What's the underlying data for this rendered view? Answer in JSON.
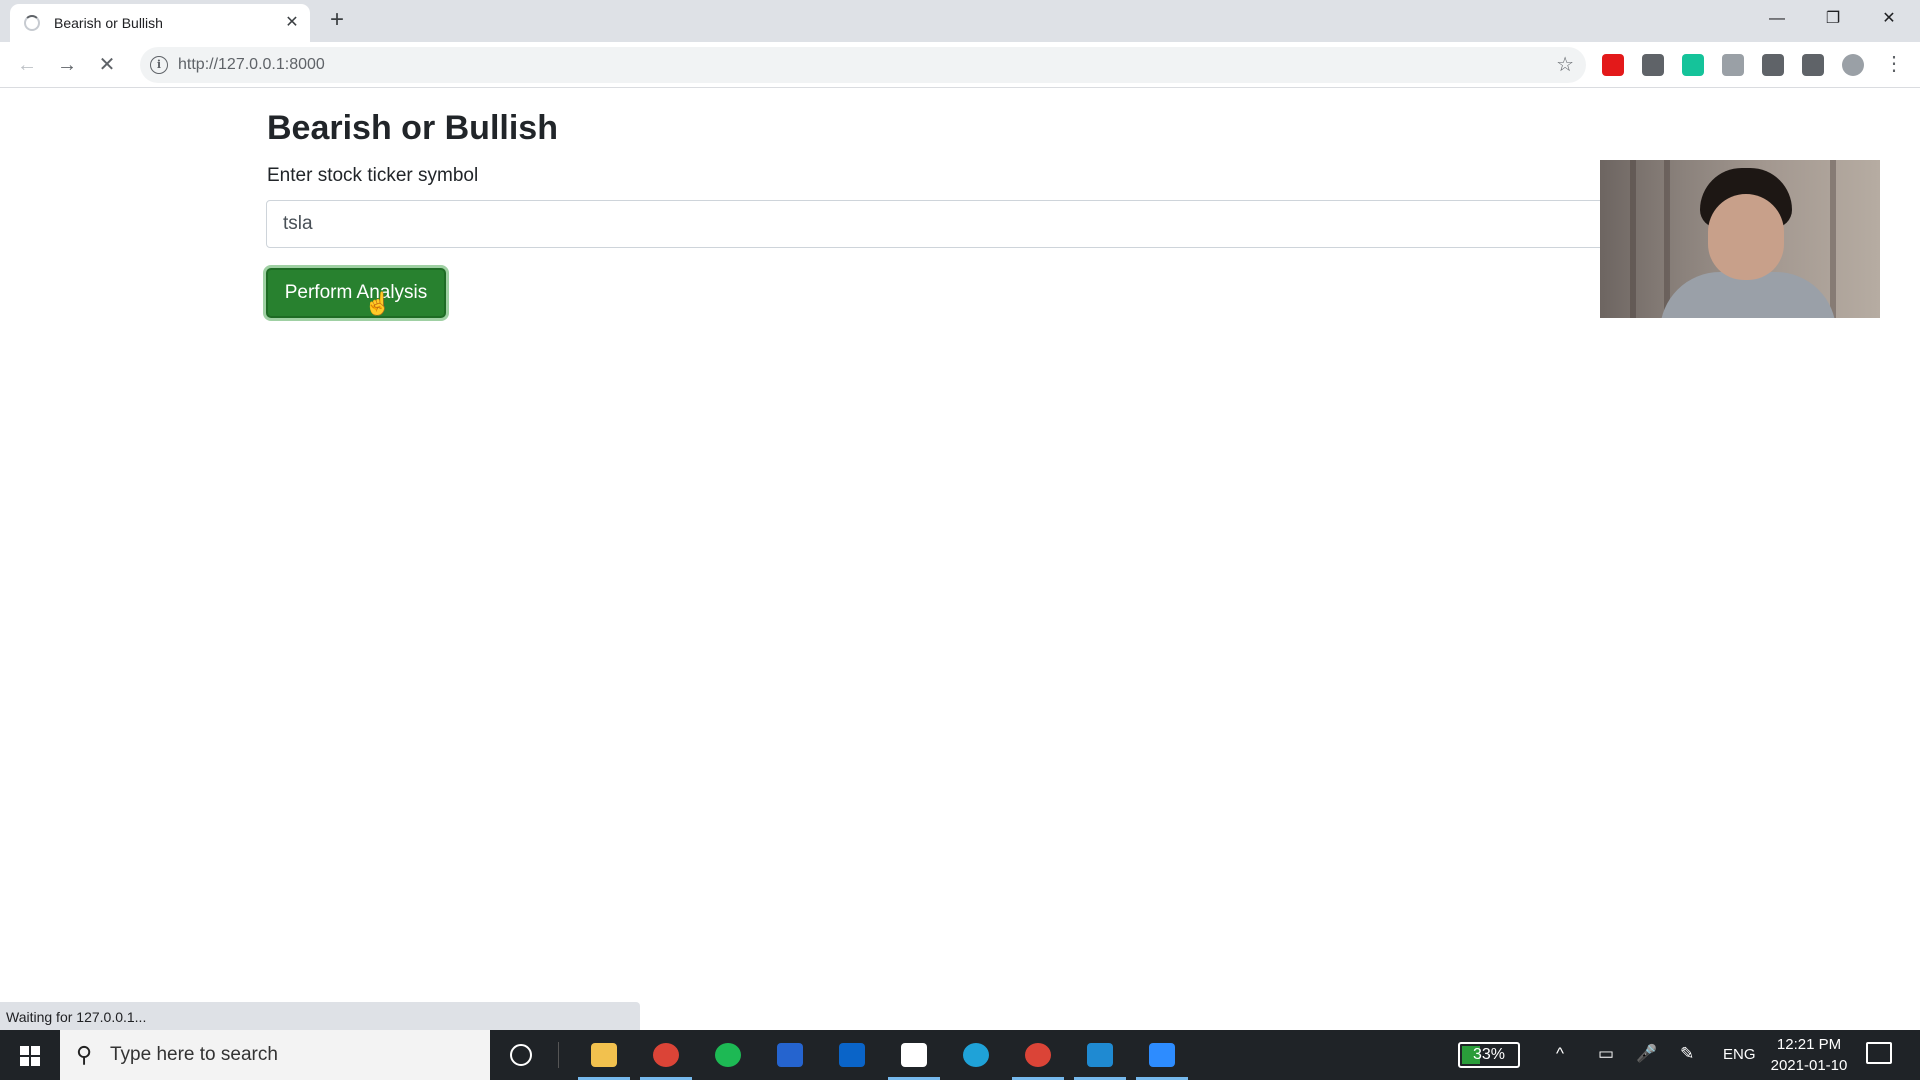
{
  "browser": {
    "tab_title": "Bearish or Bullish",
    "tab_close": "✕",
    "new_tab": "+",
    "url": "http://127.0.0.1:8000",
    "window_controls": {
      "minimize": "—",
      "restore": "❐",
      "close": "✕"
    },
    "nav": {
      "back": "←",
      "forward": "→",
      "stop": "✕"
    },
    "star": "☆",
    "menu": "⋮",
    "extensions": [
      {
        "name": "opera-extension-icon",
        "color": "#e3191a"
      },
      {
        "name": "signature-extension-icon",
        "color": "#5f6368"
      },
      {
        "name": "grammarly-extension-icon",
        "color": "#15c39a"
      },
      {
        "name": "translate-extension-icon",
        "color": "#9aa0a6"
      },
      {
        "name": "facebook-extension-icon",
        "color": "#5f6368"
      },
      {
        "name": "puzzle-extension-icon",
        "color": "#5f6368"
      },
      {
        "name": "profile-avatar-icon",
        "color": "#9aa0a6"
      }
    ]
  },
  "page": {
    "title": "Bearish or Bullish",
    "field_label": "Enter stock ticker symbol",
    "ticker_value": "tsla",
    "button_label": "Perform Analysis",
    "cursor": "☝",
    "accent_color": "#28812f"
  },
  "status_text": "Waiting for 127.0.0.1...",
  "taskbar": {
    "search_placeholder": "Type here to search",
    "search_glyph": "⚲",
    "apps": [
      {
        "name": "file-explorer-icon",
        "color": "#f2c14e",
        "active": true
      },
      {
        "name": "chrome-icon",
        "color": "#db4437",
        "active": true
      },
      {
        "name": "spotify-icon",
        "color": "#1db954",
        "active": false
      },
      {
        "name": "todo-icon",
        "color": "#2564cf",
        "active": false
      },
      {
        "name": "mail-icon",
        "color": "#0a64c8",
        "active": false
      },
      {
        "name": "document-icon",
        "color": "#ffffff",
        "active": true
      },
      {
        "name": "edge-icon",
        "color": "#1fa2d8",
        "active": false
      },
      {
        "name": "chrome-alt-icon",
        "color": "#db4437",
        "active": true
      },
      {
        "name": "vscode-icon",
        "color": "#1f8ad2",
        "active": true
      },
      {
        "name": "zoom-icon",
        "color": "#2d8cff",
        "active": true
      }
    ],
    "battery": "33%",
    "battery_level": 0.33,
    "tray": {
      "chevron": "^",
      "meet": "▭",
      "mic": "🎤",
      "pen": "✎",
      "lang": "ENG"
    },
    "time": "12:21 PM",
    "date": "2021-01-10"
  }
}
